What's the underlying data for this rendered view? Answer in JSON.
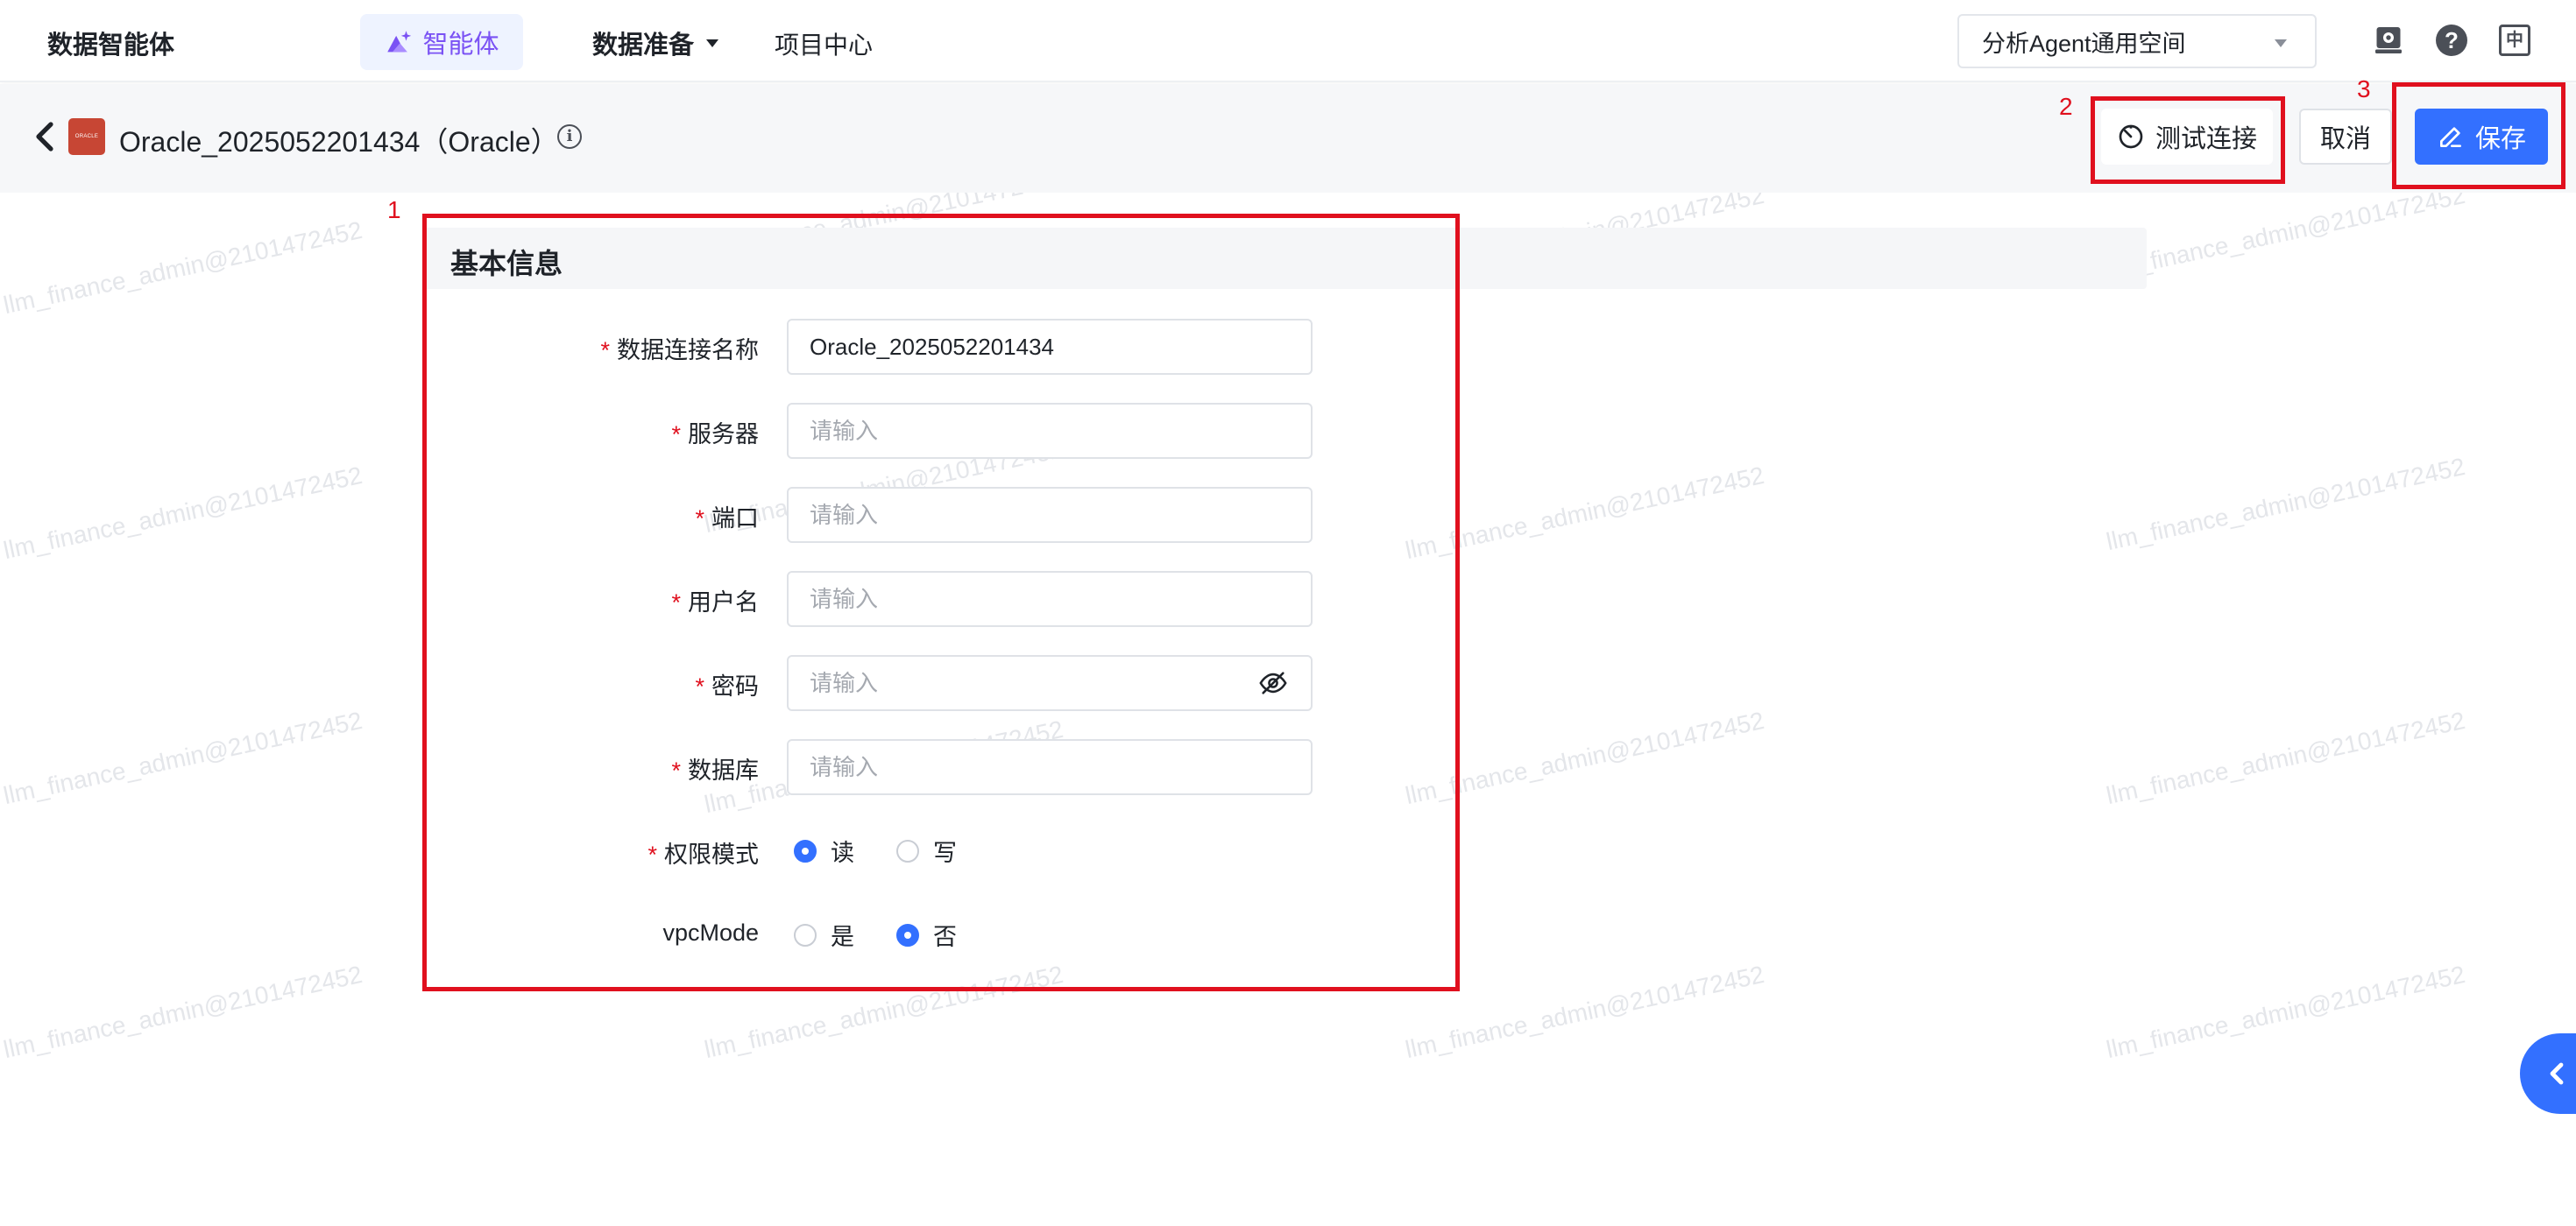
{
  "nav": {
    "brand": "数据智能体",
    "agent_label": "智能体",
    "prep_label": "数据准备",
    "project_label": "项目中心",
    "workspace": "分析Agent通用空间",
    "help_glyph": "?",
    "lang_glyph": "中"
  },
  "header": {
    "logo_text": "ORACLE",
    "title": "Oracle_2025052201434（Oracle）",
    "info_glyph": "i",
    "test_label": "测试连接",
    "cancel_label": "取消",
    "save_label": "保存"
  },
  "annotations": [
    "1",
    "2",
    "3"
  ],
  "form": {
    "section_title": "基本信息",
    "required_mark": "*",
    "fields": [
      {
        "label": "数据连接名称",
        "value": "Oracle_2025052201434",
        "placeholder": "请输入"
      },
      {
        "label": "服务器",
        "value": "",
        "placeholder": "请输入"
      },
      {
        "label": "端口",
        "value": "",
        "placeholder": "请输入"
      },
      {
        "label": "用户名",
        "value": "",
        "placeholder": "请输入"
      },
      {
        "label": "密码",
        "value": "",
        "placeholder": "请输入"
      },
      {
        "label": "数据库",
        "value": "",
        "placeholder": "请输入"
      }
    ],
    "permission": {
      "label": "权限模式",
      "options": [
        "读",
        "写"
      ],
      "selected": "读"
    },
    "vpc": {
      "label": "vpcMode",
      "options": [
        "是",
        "否"
      ],
      "selected": "否"
    }
  },
  "watermark_text": "llm_finance_admin@2101472452",
  "colors": {
    "primary": "#3370ff",
    "annotation_red": "#e0101e",
    "agent_purple": "#7a52f4",
    "oracle_red": "#c74634"
  }
}
